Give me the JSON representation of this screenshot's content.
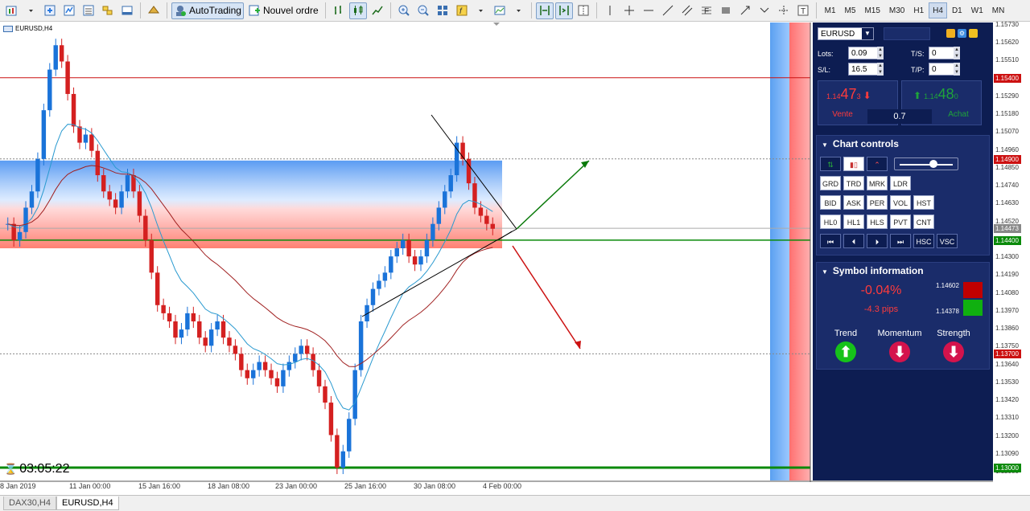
{
  "toolbar": {
    "autotrading_label": "AutoTrading",
    "new_order_label": "Nouvel ordre",
    "timeframes": [
      "M1",
      "M5",
      "M15",
      "M30",
      "H1",
      "H4",
      "D1",
      "W1",
      "MN"
    ],
    "active_timeframe": "H4",
    "text_tool": "T",
    "fib_tool": "F"
  },
  "chart": {
    "symbol_label": "EURUSD,H4",
    "countdown": "03:05:22",
    "price_axis": [
      "1.15730",
      "1.15620",
      "1.15510",
      "1.15400",
      "1.15290",
      "1.15180",
      "1.15070",
      "1.14960",
      "1.14850",
      "1.14740",
      "1.14630",
      "1.14520",
      "1.14410",
      "1.14300",
      "1.14190",
      "1.14080",
      "1.13970",
      "1.13860",
      "1.13750",
      "1.13640",
      "1.13530",
      "1.13420",
      "1.13310",
      "1.13200",
      "1.13090",
      "1.12980"
    ],
    "price_tags": [
      {
        "label": "1.15400",
        "color": "#cc1111"
      },
      {
        "label": "1.14900",
        "color": "#cc1111"
      },
      {
        "label": "1.14473",
        "color": "#888888"
      },
      {
        "label": "1.14400",
        "color": "#0a8a0a"
      },
      {
        "label": "1.13700",
        "color": "#cc1111"
      },
      {
        "label": "1.13000",
        "color": "#0a8a0a"
      }
    ],
    "time_axis": [
      "8 Jan 2019",
      "11 Jan 00:00",
      "15 Jan 16:00",
      "18 Jan 08:00",
      "23 Jan 00:00",
      "25 Jan 16:00",
      "30 Jan 08:00",
      "4 Feb 00:00"
    ]
  },
  "panel": {
    "symbol": "EURUSD",
    "symbol_extra": "",
    "lots_label": "Lots:",
    "lots_value": "0.09",
    "sl_label": "S/L:",
    "sl_value": "16.5",
    "ts_label": "T/S:",
    "ts_value": "0",
    "tp_label": "T/P:",
    "tp_value": "0",
    "sell": {
      "prefix": "1.14",
      "big": "47",
      "suffix": "3",
      "label": "Vente"
    },
    "buy": {
      "prefix": "1.14",
      "big": "48",
      "suffix": "0",
      "label": "Achat"
    },
    "spread": "0.7",
    "chart_controls": {
      "title": "Chart controls",
      "row2": [
        "GRD",
        "TRD",
        "MRK",
        "LDR"
      ],
      "row3": [
        "BID",
        "ASK",
        "PER",
        "VOL",
        "HST"
      ],
      "row4": [
        "HL0",
        "HL1",
        "HLS",
        "PVT",
        "CNT"
      ],
      "row5": [
        "⏮",
        "⏴",
        "⏵",
        "⏭",
        "HSC",
        "VSC"
      ]
    },
    "symbol_info": {
      "title": "Symbol information",
      "change_pct": "-0.04%",
      "change_pips": "-4.3 pips",
      "high": "1.14602",
      "low": "1.14378",
      "trend_label": "Trend",
      "momentum_label": "Momentum",
      "strength_label": "Strength",
      "trend_arrow": "⬆",
      "momentum_arrow": "⬇",
      "strength_arrow": "⬇"
    },
    "colors": {
      "bg": "#0d1d52",
      "sell": "#ff3b3b",
      "buy": "#1fa33a",
      "up": "#16c21a",
      "down": "#d4134c"
    }
  },
  "tabs": [
    {
      "label": "DAX30,H4",
      "active": false
    },
    {
      "label": "EURUSD,H4",
      "active": true
    }
  ]
}
